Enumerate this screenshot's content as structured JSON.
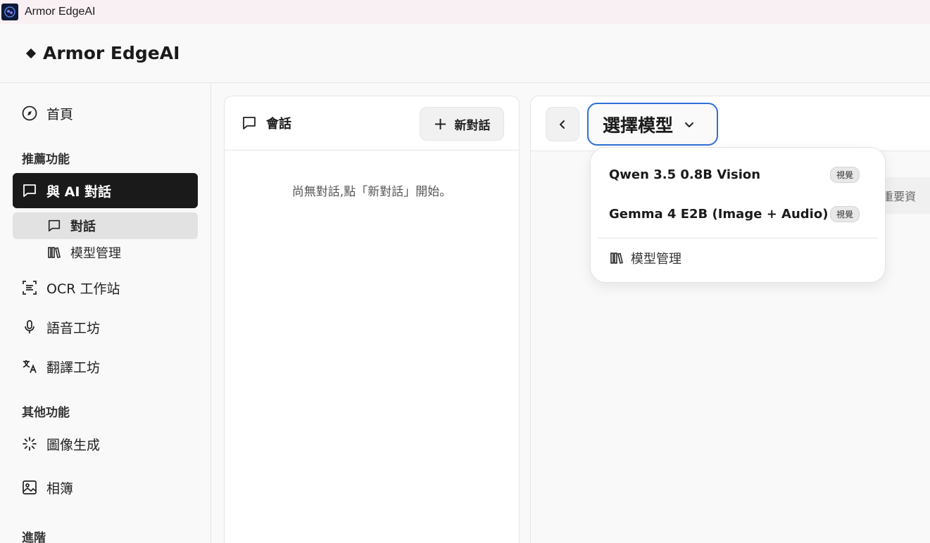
{
  "window": {
    "title": "Armor EdgeAI",
    "app_icon": "brain-icon"
  },
  "header": {
    "brand": "Armor EdgeAI",
    "brand_icon": "diamond-icon"
  },
  "sidebar": {
    "home": {
      "label": "首頁",
      "icon": "compass-icon"
    },
    "section_recommended": "推薦功能",
    "ai_chat": {
      "label": "與 AI 對話",
      "icon": "chat-bubble-icon"
    },
    "sub_chat": {
      "label": "對話",
      "icon": "chat-bubble-icon"
    },
    "sub_models": {
      "label": "模型管理",
      "icon": "library-icon"
    },
    "ocr": {
      "label": "OCR 工作站",
      "icon": "scan-text-icon"
    },
    "voice": {
      "label": "語音工坊",
      "icon": "microphone-icon"
    },
    "translate": {
      "label": "翻譯工坊",
      "icon": "translate-icon"
    },
    "section_other": "其他功能",
    "image_gen": {
      "label": "圖像生成",
      "icon": "sparkle-loader-icon"
    },
    "album": {
      "label": "相簿",
      "icon": "image-icon"
    },
    "section_advanced": "進階"
  },
  "conversations": {
    "title": "會話",
    "new_chat_label": "新對話",
    "empty_message": "尚無對話,點「新對話」開始。"
  },
  "chat": {
    "model_select_label": "選擇模型",
    "notice_fragment": "等,重要資"
  },
  "model_dropdown": {
    "options": [
      {
        "name": "Qwen 3.5 0.8B Vision",
        "badge": "視覺"
      },
      {
        "name": "Gemma 4 E2B (Image + Audio)",
        "badge": "視覺"
      }
    ],
    "manage_label": "模型管理"
  },
  "colors": {
    "accent": "#2f6fd6",
    "active_nav": "#1a1a1a"
  }
}
